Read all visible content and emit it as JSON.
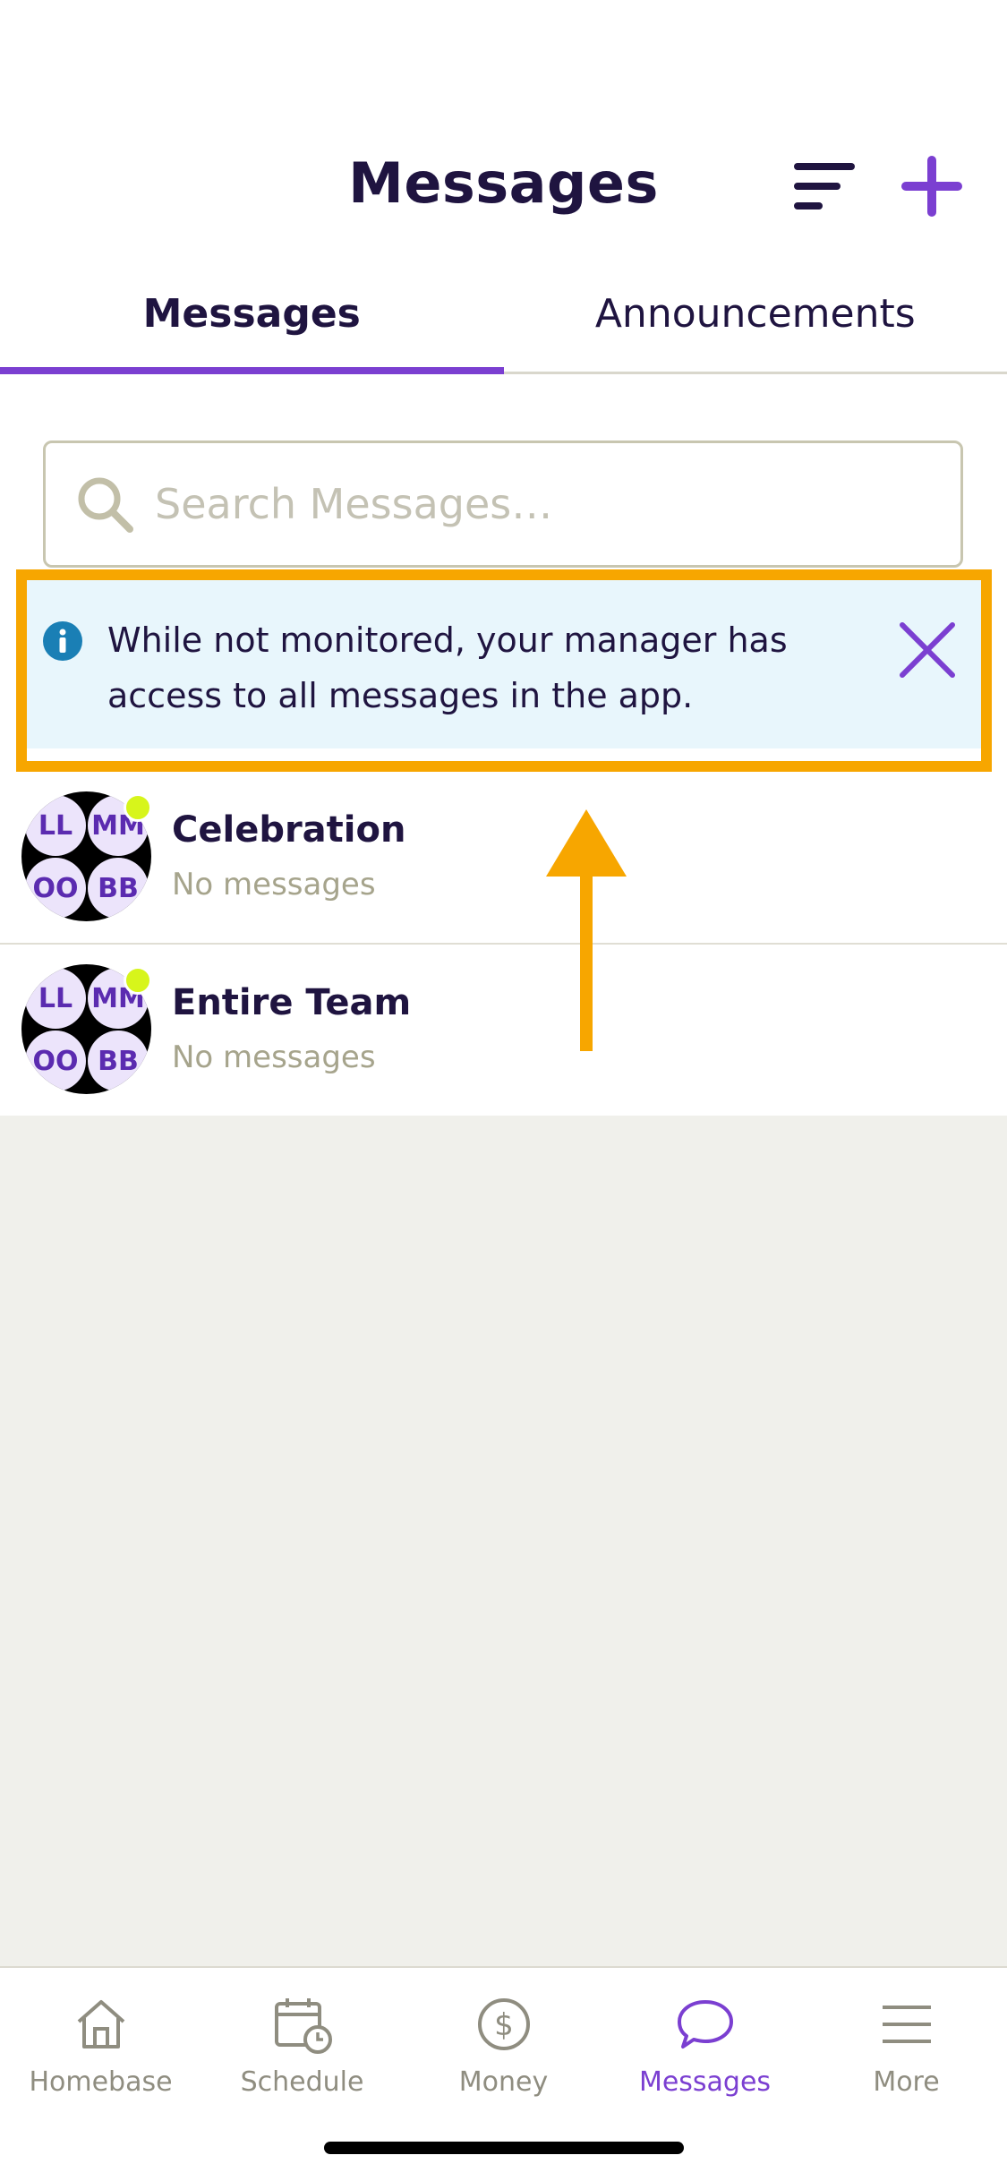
{
  "header": {
    "title": "Messages"
  },
  "tabs": [
    {
      "label": "Messages",
      "active": true
    },
    {
      "label": "Announcements",
      "active": false
    }
  ],
  "search": {
    "placeholder": "Search Messages…",
    "value": ""
  },
  "banner": {
    "text": "While not monitored, your manager has access to all messages in the app."
  },
  "conversations": [
    {
      "title": "Celebration",
      "subtitle": "No messages",
      "avatar_initials": [
        "LL",
        "MM",
        "OO",
        "BB"
      ]
    },
    {
      "title": "Entire Team",
      "subtitle": "No messages",
      "avatar_initials": [
        "LL",
        "MM",
        "OO",
        "BB"
      ]
    }
  ],
  "bottom_nav": [
    {
      "label": "Homebase",
      "icon": "home-icon",
      "active": false
    },
    {
      "label": "Schedule",
      "icon": "calendar-clock-icon",
      "active": false
    },
    {
      "label": "Money",
      "icon": "dollar-circle-icon",
      "active": false
    },
    {
      "label": "Messages",
      "icon": "chat-bubble-icon",
      "active": true
    },
    {
      "label": "More",
      "icon": "hamburger-menu-icon",
      "active": false
    }
  ],
  "colors": {
    "accent": "#7b3fd1",
    "highlight": "#f7a600",
    "banner_bg": "#e8f6fc",
    "info_icon": "#1a7fb5",
    "presence": "#d7f51b"
  }
}
